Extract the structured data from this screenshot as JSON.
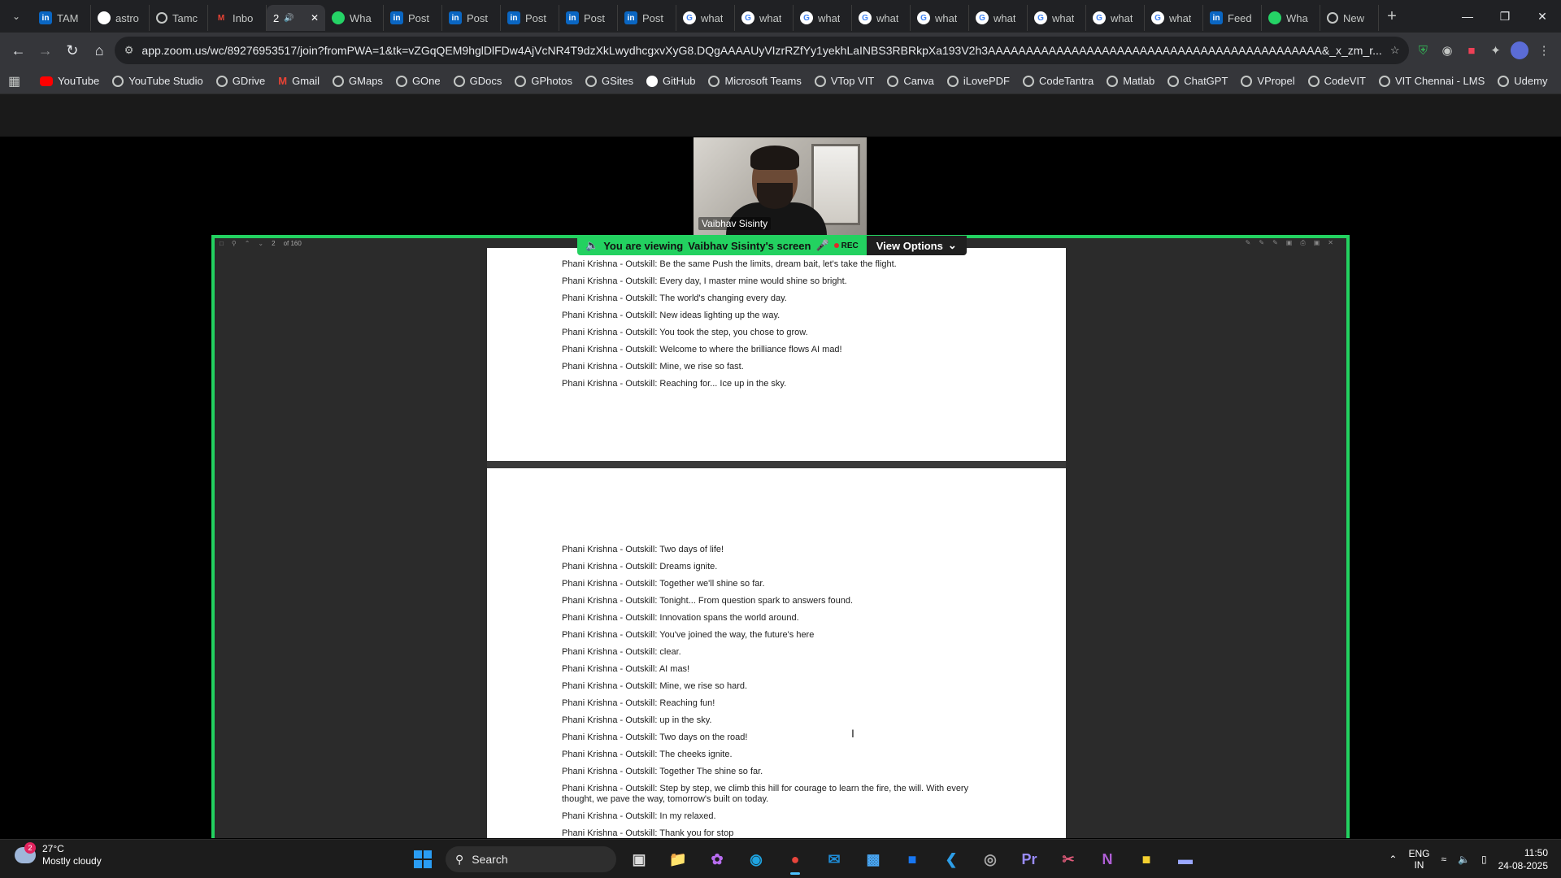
{
  "tabs": [
    {
      "title": "TAM",
      "icon": "linkedin"
    },
    {
      "title": "astro",
      "icon": "github"
    },
    {
      "title": "Tamc",
      "icon": "globe"
    },
    {
      "title": "Inbo",
      "icon": "gmail"
    },
    {
      "title": "2",
      "icon": "audio",
      "active": true
    },
    {
      "title": "Wha",
      "icon": "whatsapp"
    },
    {
      "title": "Post",
      "icon": "linkedin"
    },
    {
      "title": "Post",
      "icon": "linkedin"
    },
    {
      "title": "Post",
      "icon": "linkedin"
    },
    {
      "title": "Post",
      "icon": "linkedin"
    },
    {
      "title": "Post",
      "icon": "linkedin"
    },
    {
      "title": "what",
      "icon": "google"
    },
    {
      "title": "what",
      "icon": "google"
    },
    {
      "title": "what",
      "icon": "google"
    },
    {
      "title": "what",
      "icon": "google"
    },
    {
      "title": "what",
      "icon": "google"
    },
    {
      "title": "what",
      "icon": "google"
    },
    {
      "title": "what",
      "icon": "google"
    },
    {
      "title": "what",
      "icon": "google"
    },
    {
      "title": "what",
      "icon": "google"
    },
    {
      "title": "Feed",
      "icon": "linkedin"
    },
    {
      "title": "Wha",
      "icon": "whatsapp"
    },
    {
      "title": "New",
      "icon": "globe"
    }
  ],
  "address": {
    "url": "app.zoom.us/wc/89276953517/join?fromPWA=1&tk=vZGqQEM9hglDlFDw4AjVcNR4T9dzXkLwydhcgxvXyG8.DQgAAAAUyVIzrRZfYy1yekhLaINBS3RBRkpXa193V2h3AAAAAAAAAAAAAAAAAAAAAAAAAAAAAAAAAAAAAAAAAAAA&_x_zm_r..."
  },
  "bookmarks": [
    "YouTube",
    "YouTube Studio",
    "GDrive",
    "Gmail",
    "GMaps",
    "GOne",
    "GDocs",
    "GPhotos",
    "GSites",
    "GitHub",
    "Microsoft Teams",
    "VTop VIT",
    "Canva",
    "iLovePDF",
    "CodeTantra",
    "Matlab",
    "ChatGPT",
    "VPropel",
    "CodeVIT",
    "VIT Chennai - LMS",
    "Udemy"
  ],
  "zoom": {
    "participant_name": "Vaibhav Sisinty",
    "banner_prefix": "You are viewing",
    "banner_owner": "Vaibhav Sisinty's screen",
    "rec_label": "REC",
    "view_options": "View Options",
    "pdf_page_current": "2",
    "pdf_page_total": "of 160"
  },
  "pdf": {
    "page1_lines": [
      "Phani Krishna - Outskill: Be the same Push the limits, dream bait, let's take the flight.",
      "Phani Krishna - Outskill: Every day, I master mine would shine so bright.",
      "Phani Krishna - Outskill: The world's changing every day.",
      "Phani Krishna - Outskill: New ideas lighting up the way.",
      "Phani Krishna - Outskill: You took the step, you chose to grow.",
      "Phani Krishna - Outskill: Welcome to where the brilliance flows AI mad!",
      "Phani Krishna - Outskill: Mine, we rise so fast.",
      "Phani Krishna - Outskill: Reaching for... Ice up in the sky."
    ],
    "page2_lines": [
      "Phani Krishna - Outskill: Two days of life!",
      "Phani Krishna - Outskill: Dreams ignite.",
      "Phani Krishna - Outskill: Together we'll shine so far.",
      "Phani Krishna - Outskill: Tonight... From question spark to answers found.",
      "Phani Krishna - Outskill: Innovation spans the world around.",
      "Phani Krishna - Outskill: You've joined the way, the future's here",
      "Phani Krishna - Outskill: clear.",
      "Phani Krishna - Outskill: AI mas!",
      "Phani Krishna - Outskill: Mine, we rise so hard.",
      "Phani Krishna - Outskill: Reaching fun!",
      "Phani Krishna - Outskill: up in the sky.",
      "Phani Krishna - Outskill: Two days on the road!",
      "Phani Krishna - Outskill: The cheeks ignite.",
      "Phani Krishna - Outskill: Together The shine so far.",
      "Phani Krishna - Outskill: Step by step, we climb this hill for courage to learn the fire, the will. With every thought, we pave the way, tomorrow's built on today.",
      "Phani Krishna - Outskill: In my relaxed.",
      "Phani Krishna - Outskill: Thank you for stop"
    ]
  },
  "taskbar": {
    "weather_badge": "2",
    "temperature": "27°C",
    "condition": "Mostly cloudy",
    "search_label": "Search",
    "lang_top": "ENG",
    "lang_bottom": "IN",
    "time": "11:50",
    "date": "24-08-2025"
  }
}
